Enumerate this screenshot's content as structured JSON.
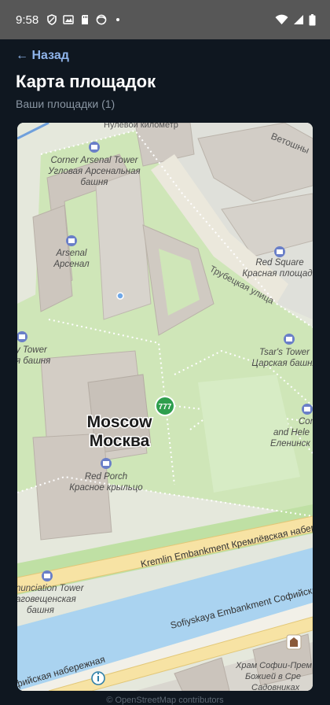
{
  "status_bar": {
    "time": "9:58",
    "left_icons": [
      "shield-icon",
      "image-icon",
      "sd-card-icon",
      "face-icon",
      "dot-icon"
    ],
    "right_icons": [
      "wifi-icon",
      "signal-icon",
      "battery-icon"
    ]
  },
  "header": {
    "back_label": "← Назад",
    "title": "Карта площадок",
    "subtitle": "Ваши площадки (1)"
  },
  "map": {
    "labels": {
      "nulevoy": "Нулевой километр",
      "vetoshny": "Ветошны",
      "corner_arsenal_en": "Corner Arsenal Tower",
      "corner_arsenal_ru1": "Угловая Арсенальная",
      "corner_arsenal_ru2": "башня",
      "arsenal_en": "Arsenal",
      "arsenal_ru": "Арсенал",
      "red_square_en": "Red Square",
      "red_square_ru": "Красная площадь",
      "trubetskaya": "Трубецкая улица",
      "tower_left_en": "y Tower",
      "tower_left_ru": "я башня",
      "tsars_tower_en": "Tsar's Tower",
      "tsars_tower_ru": "Царская башня",
      "moscow_en": "Moscow",
      "moscow_ru": "Москва",
      "constantine1": "Constа",
      "constantine2": "and Hele",
      "constantine3": "Еленинск",
      "red_porch_en": "Red Porch",
      "red_porch_ru": "Красное крыльцо",
      "kremlin_emb": "Kremlin Embankment Кремлёвская набережная",
      "annunciation_en": "nunciation Tower",
      "annunciation_ru1": "аговещенская",
      "annunciation_ru2": "башня",
      "sofiyskaya": "Sofiyskaya Embankment Софийская",
      "sofiyskaya_ru": "фийская набережная",
      "church1": "Храм Софии-Прем",
      "church2": "Божией в Сре",
      "church3": "Садовниках"
    },
    "marker_label": "777",
    "attribution": "© OpenStreetMap contributors",
    "colors": {
      "land": "#e8ebe0",
      "park": "#c9e6b0",
      "river": "#aad3f0",
      "road": "#f7e3a4",
      "building": "#cfc8c1",
      "marker": "#2e9e4d"
    }
  }
}
